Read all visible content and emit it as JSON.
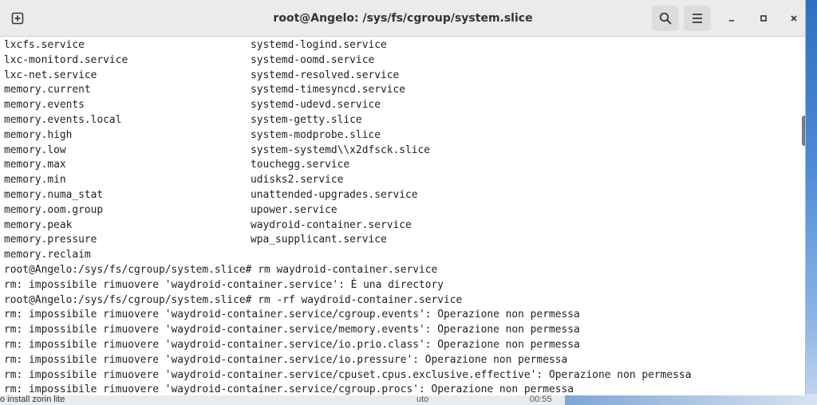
{
  "window": {
    "title": "root@Angelo: /sys/fs/cgroup/system.slice"
  },
  "listing": [
    [
      "lxcfs.service",
      "systemd-logind.service"
    ],
    [
      "lxc-monitord.service",
      "systemd-oomd.service"
    ],
    [
      "lxc-net.service",
      "systemd-resolved.service"
    ],
    [
      "memory.current",
      "systemd-timesyncd.service"
    ],
    [
      "memory.events",
      "systemd-udevd.service"
    ],
    [
      "memory.events.local",
      "system-getty.slice"
    ],
    [
      "memory.high",
      "system-modprobe.slice"
    ],
    [
      "memory.low",
      "system-systemd\\\\x2dfsck.slice"
    ],
    [
      "memory.max",
      "touchegg.service"
    ],
    [
      "memory.min",
      "udisks2.service"
    ],
    [
      "memory.numa_stat",
      "unattended-upgrades.service"
    ],
    [
      "memory.oom.group",
      "upower.service"
    ],
    [
      "memory.peak",
      "waydroid-container.service"
    ],
    [
      "memory.pressure",
      "wpa_supplicant.service"
    ],
    [
      "memory.reclaim",
      ""
    ]
  ],
  "output": [
    "root@Angelo:/sys/fs/cgroup/system.slice# rm waydroid-container.service",
    "rm: impossibile rimuovere 'waydroid-container.service': È una directory",
    "root@Angelo:/sys/fs/cgroup/system.slice# rm -rf waydroid-container.service",
    "rm: impossibile rimuovere 'waydroid-container.service/cgroup.events': Operazione non permessa",
    "rm: impossibile rimuovere 'waydroid-container.service/memory.events': Operazione non permessa",
    "rm: impossibile rimuovere 'waydroid-container.service/io.prio.class': Operazione non permessa",
    "rm: impossibile rimuovere 'waydroid-container.service/io.pressure': Operazione non permessa",
    "rm: impossibile rimuovere 'waydroid-container.service/cpuset.cpus.exclusive.effective': Operazione non permessa",
    "rm: impossibile rimuovere 'waydroid-container.service/cgroup.procs': Operazione non permessa"
  ],
  "background": {
    "bottom_left_text": "o install zorin lite",
    "bottom_mid_text": "uto",
    "bottom_time": "00:55"
  },
  "icons": {
    "new_tab": "new-tab-icon",
    "search": "search-icon",
    "menu": "hamburger-menu-icon",
    "minimize": "minimize-icon",
    "maximize": "maximize-icon",
    "close": "close-icon"
  }
}
